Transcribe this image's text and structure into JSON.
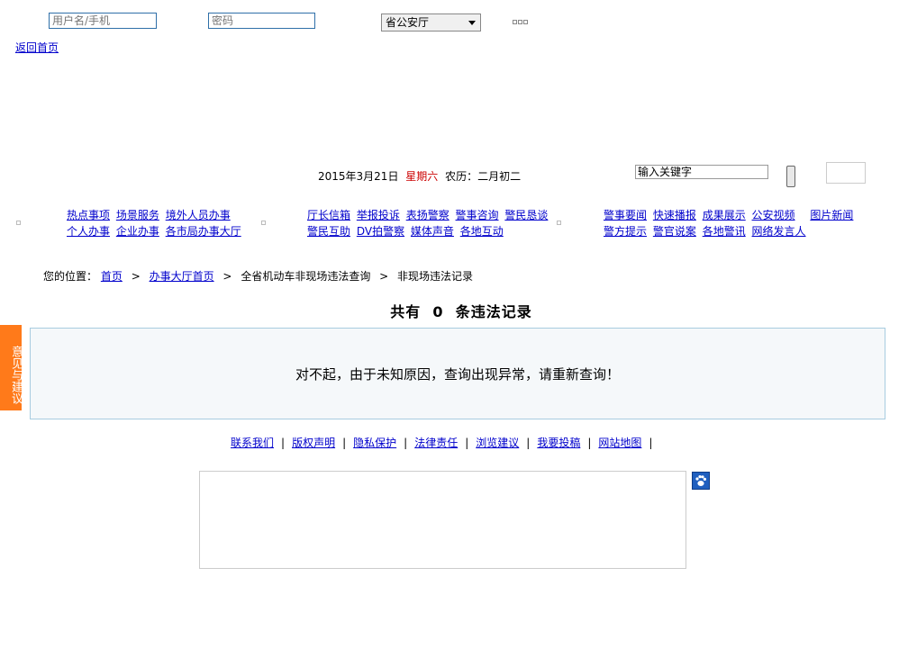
{
  "login": {
    "username_placeholder": "用户名/手机",
    "password_placeholder": "密码",
    "department_selected": "省公安厅"
  },
  "back_home": "返回首页",
  "date_bar": {
    "date": "2015年3月21日",
    "weekday": "星期六",
    "lunar": "农历：二月初二"
  },
  "search": {
    "value": "输入关键字"
  },
  "nav": {
    "group1": {
      "row1": [
        "热点事项",
        "场景服务",
        "境外人员办事"
      ],
      "row2": [
        "个人办事",
        "企业办事",
        "各市局办事大厅"
      ]
    },
    "group2": {
      "row1": [
        "厅长信箱",
        "举报投诉",
        "表扬警察",
        "警事咨询",
        "警民恳谈"
      ],
      "row2": [
        "警民互助",
        "DV拍警察",
        "媒体声音",
        "各地互动"
      ]
    },
    "group3": {
      "row1": [
        "警事要闻",
        "快速播报",
        "成果展示",
        "公安视频",
        "图片新闻"
      ],
      "row2": [
        "警方提示",
        "警官说案",
        "各地警讯",
        "网络发言人"
      ]
    }
  },
  "breadcrumb": {
    "prefix": "您的位置：",
    "items": [
      "首页",
      "办事大厅首页",
      "全省机动车非现场违法查询",
      "非现场违法记录"
    ],
    "separator": ">"
  },
  "result": {
    "total": "共有  0  条违法记录",
    "message": "对不起，由于未知原因，查询出现异常，请重新查询！"
  },
  "feedback_tab": "意见与建议",
  "footer": {
    "links": [
      "联系我们",
      "版权声明",
      "隐私保护",
      "法律责任",
      "浏览建议",
      "我要投稿",
      "网站地图"
    ],
    "separator": "|"
  },
  "colors": {
    "link": "#0000cc",
    "weekday": "#cc0000",
    "feedback_bg": "#ff7a1a",
    "message_border": "#a8cce0"
  }
}
